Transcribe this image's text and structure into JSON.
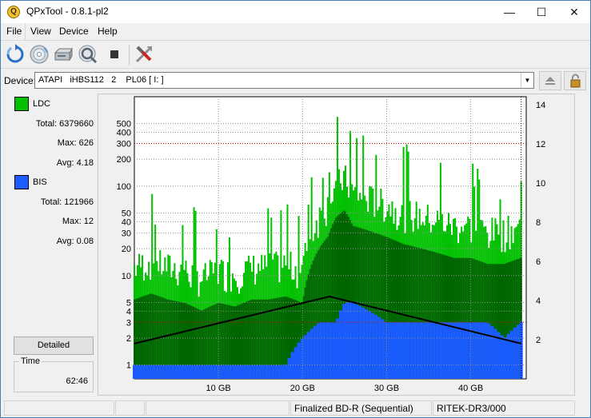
{
  "window": {
    "title": "QPxTool - 0.8.1-pl2",
    "minimize": "—",
    "maximize": "☐",
    "close": "✕"
  },
  "menu": [
    "File",
    "View",
    "Device",
    "Help"
  ],
  "toolbar": {
    "icons": [
      "refresh-icon",
      "disc-icon",
      "drive-icon",
      "magnifier-disc-icon",
      "stop-icon",
      "tools-icon"
    ]
  },
  "device": {
    "label": "Device:",
    "value": "ATAPI   iHBS112   2    PL06 [ I: ]",
    "eject_icon": "eject-icon",
    "lock_icon": "lock-icon"
  },
  "stats": {
    "ldc": {
      "label": "LDC",
      "color": "#00c000",
      "total_label": "Total:",
      "total": "6379660",
      "max_label": "Max:",
      "max": "626",
      "avg_label": "Avg:",
      "avg": "4.18"
    },
    "bis": {
      "label": "BIS",
      "color": "#1a5cff",
      "total_label": "Total:",
      "total": "121966",
      "max_label": "Max:",
      "max": "12",
      "avg_label": "Avg:",
      "avg": "0.08"
    },
    "detailed_button": "Detailed",
    "time_label": "Time",
    "time_value": "62:46"
  },
  "status": {
    "cell1": "",
    "cell2": "",
    "cell3": "",
    "disc_type": "Finalized BD-R (Sequential)",
    "media_id": "RITEK-DR3/000"
  },
  "chart_data": {
    "type": "area",
    "title": "",
    "x_unit": "GB",
    "x_range": [
      0,
      46.6
    ],
    "x_ticks": [
      10,
      20,
      30,
      40
    ],
    "x_tick_labels": [
      "10 GB",
      "20 GB",
      "30 GB",
      "40 GB"
    ],
    "y_left_scale": "log",
    "y_left_range": [
      0.7,
      1000
    ],
    "y_left_ticks": [
      1,
      2,
      3,
      4,
      5,
      10,
      20,
      30,
      40,
      50,
      100,
      200,
      300,
      400,
      500
    ],
    "y_right_range": [
      0,
      14.4
    ],
    "y_right_ticks": [
      2,
      4,
      6,
      8,
      10,
      12,
      14
    ],
    "colors": {
      "ldc": "#00c000",
      "ldc_dark": "#006400",
      "bis": "#1a5cff",
      "speed": "#000000",
      "grid": "#909090",
      "limit": "#c00000"
    },
    "limit_lines_left": [
      300,
      3
    ],
    "series": [
      {
        "name": "LDC",
        "x": [
          0,
          2,
          4,
          6,
          8,
          10,
          12,
          14,
          16,
          18,
          20,
          21,
          22,
          23,
          24,
          25,
          26,
          28,
          30,
          32,
          34,
          36,
          38,
          40,
          42,
          44,
          46
        ],
        "values": [
          12,
          14,
          12,
          11,
          9,
          11,
          10,
          12,
          12,
          13,
          11,
          28,
          45,
          60,
          100,
          120,
          80,
          70,
          60,
          50,
          45,
          40,
          35,
          35,
          30,
          30,
          35
        ]
      },
      {
        "name": "BIS",
        "x": [
          0,
          2,
          4,
          6,
          8,
          10,
          12,
          14,
          16,
          18,
          20,
          22,
          23,
          24,
          25,
          26,
          28,
          30,
          32,
          34,
          36,
          38,
          40,
          42,
          44,
          46
        ],
        "values": [
          1,
          1,
          1,
          1,
          1,
          1,
          1,
          1,
          1,
          1,
          2,
          3,
          3,
          3,
          5,
          5,
          4,
          3,
          3,
          3,
          3,
          3,
          3,
          3,
          2,
          3
        ]
      },
      {
        "name": "Read speed",
        "axis": "right",
        "x": [
          0,
          23.2,
          46
        ],
        "values": [
          1.8,
          4.2,
          1.8
        ]
      }
    ]
  }
}
